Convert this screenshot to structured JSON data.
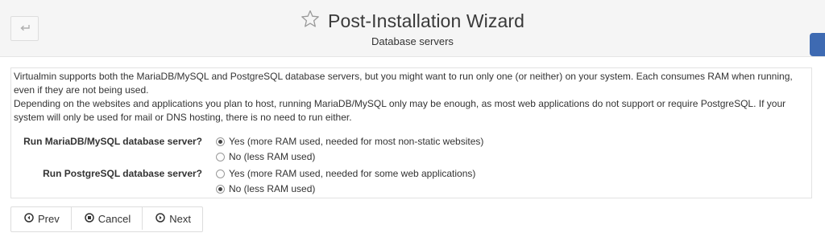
{
  "header": {
    "title": "Post-Installation Wizard",
    "subtitle": "Database servers"
  },
  "intro": {
    "paragraph1": "Virtualmin supports both the MariaDB/MySQL and PostgreSQL database servers, but you might want to run only one (or neither) on your system. Each consumes RAM when running, even if they are not being used.",
    "paragraph2": "Depending on the websites and applications you plan to host, running MariaDB/MySQL only may be enough, as most web applications do not support or require PostgreSQL. If your system will only be used for mail or DNS hosting, there is no need to run either."
  },
  "mysql": {
    "label": "Run MariaDB/MySQL database server?",
    "options": [
      {
        "label": "Yes (more RAM used, needed for most non-static websites)",
        "checked": true
      },
      {
        "label": "No (less RAM used)",
        "checked": false
      }
    ]
  },
  "postgres": {
    "label": "Run PostgreSQL database server?",
    "options": [
      {
        "label": "Yes (more RAM used, needed for some web applications)",
        "checked": false
      },
      {
        "label": "No (less RAM used)",
        "checked": true
      }
    ]
  },
  "buttons": {
    "prev": "Prev",
    "cancel": "Cancel",
    "next": "Next"
  },
  "colors": {
    "side_tab": "#3e6ab2",
    "header_bg": "#f5f5f5"
  },
  "icons": {
    "back": "back-arrow-icon",
    "title": "star-icon",
    "prev": "circle-left-icon",
    "cancel": "circle-stop-icon",
    "next": "circle-right-icon"
  }
}
